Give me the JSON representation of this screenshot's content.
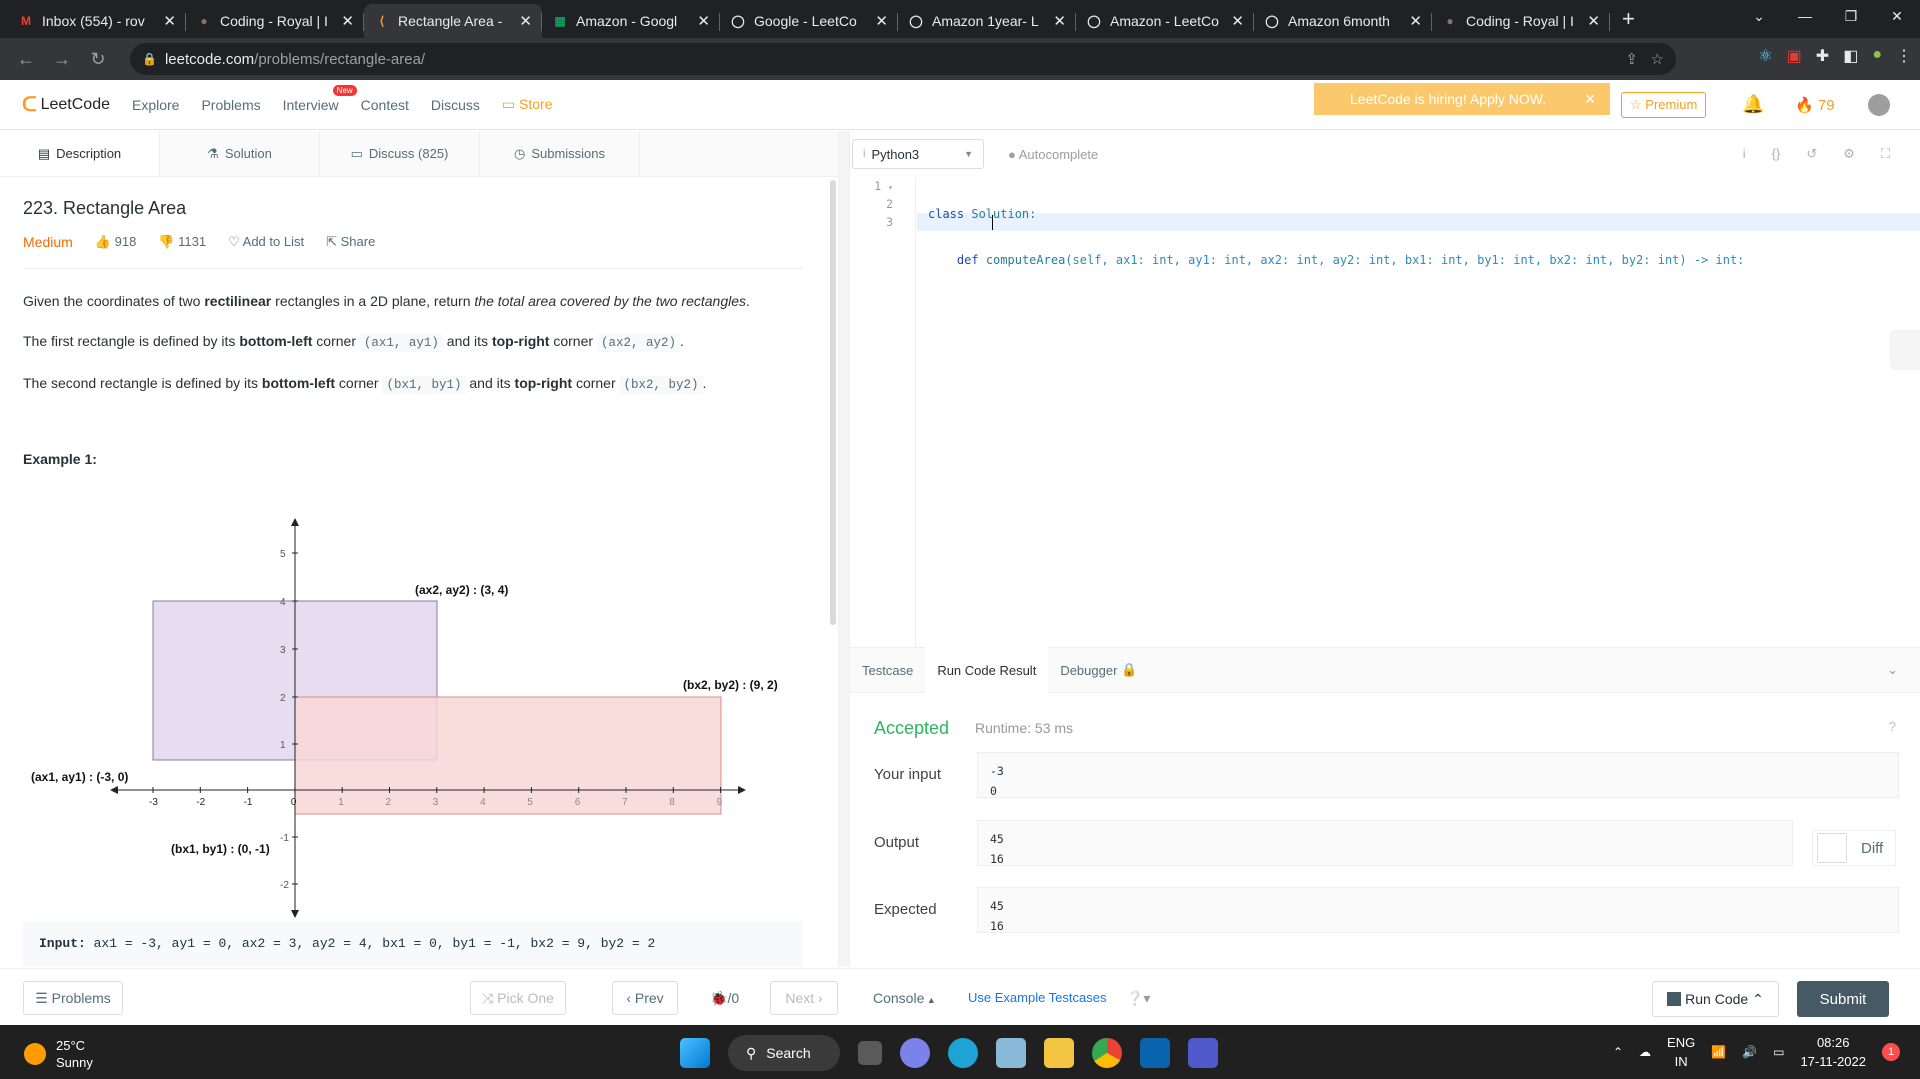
{
  "browser": {
    "tabs": [
      {
        "title": "Inbox (554) - rov",
        "icon": "gmail-icon",
        "color": "#ea4335",
        "glyph": "M"
      },
      {
        "title": "Coding - Royal | I",
        "icon": "avatar-icon",
        "color": "#8d6e63",
        "glyph": "●"
      },
      {
        "title": "Rectangle Area -",
        "icon": "leetcode-icon",
        "color": "#f89f1b",
        "glyph": "⟨"
      },
      {
        "title": "Amazon - Googl",
        "icon": "sheets-icon",
        "color": "#0f9d58",
        "glyph": "▦"
      },
      {
        "title": "Google - LeetCo",
        "icon": "leetcode-icon",
        "color": "#e8eaed",
        "glyph": "◯"
      },
      {
        "title": "Amazon 1year- L",
        "icon": "leetcode-icon",
        "color": "#e8eaed",
        "glyph": "◯"
      },
      {
        "title": "Amazon - LeetCo",
        "icon": "leetcode-icon",
        "color": "#e8eaed",
        "glyph": "◯"
      },
      {
        "title": "Amazon 6month",
        "icon": "leetcode-icon",
        "color": "#e8eaed",
        "glyph": "◯"
      },
      {
        "title": "Coding - Royal | I",
        "icon": "avatar-icon",
        "color": "#8d6e63",
        "glyph": "●"
      }
    ],
    "active_tab": 2,
    "url_host": "leetcode.com",
    "url_path": "/problems/rectangle-area/"
  },
  "nav": {
    "logo": "LeetCode",
    "links": [
      "Explore",
      "Problems",
      "Interview",
      "Contest",
      "Discuss"
    ],
    "new_badge": "New",
    "store": "Store",
    "hiring": "LeetCode is hiring! Apply NOW.",
    "premium": "Premium",
    "streak": "79"
  },
  "left_tabs": [
    "Description",
    "Solution",
    "Discuss (825)",
    "Submissions"
  ],
  "problem": {
    "title": "223. Rectangle Area",
    "difficulty": "Medium",
    "likes": "918",
    "dislikes": "1131",
    "add_to_list": "Add to List",
    "share": "Share",
    "p1_a": "Given the coordinates of two ",
    "p1_b": "rectilinear",
    "p1_c": " rectangles in a 2D plane, return ",
    "p1_d": "the total area covered by the two rectangles",
    "p1_e": ".",
    "p2_a": "The first rectangle is defined by its ",
    "p2_b": "bottom-left",
    "p2_c": " corner ",
    "p2_d": "(ax1, ay1)",
    "p2_e": " and its ",
    "p2_f": "top-right",
    "p2_g": " corner ",
    "p2_h": "(ax2, ay2)",
    "p2_i": ".",
    "p3_a": "The second rectangle is defined by its ",
    "p3_b": "bottom-left",
    "p3_c": " corner ",
    "p3_d": "(bx1, by1)",
    "p3_e": " and its ",
    "p3_f": "top-right",
    "p3_g": " corner ",
    "p3_h": "(bx2, by2)",
    "p3_i": ".",
    "example_label": "Example 1:",
    "input_label": "Input:",
    "input_text": "ax1 = -3, ay1 = 0, ax2 = 3, ay2 = 4, bx1 = 0, by1 = -1, bx2 = 9, by2 = 2",
    "graph": {
      "x_ticks": [
        "-3",
        "-2",
        "-1",
        "0",
        "1",
        "2",
        "3",
        "4",
        "5",
        "6",
        "7",
        "8",
        "9"
      ],
      "y_ticks": [
        "5",
        "4",
        "3",
        "2",
        "1",
        "-1",
        "-2"
      ],
      "label_a2": "(ax2, ay2) : (3, 4)",
      "label_b2": "(bx2, by2) : (9, 2)",
      "label_a1": "(ax1, ay1) : (-3, 0)",
      "label_b1": "(bx1, by1) : (0, -1)",
      "rect_a_color": "#e6def0",
      "rect_b_color": "#f8d7d7"
    }
  },
  "editor": {
    "language": "Python3",
    "autocomplete": "Autocomplete",
    "line_numbers": [
      "1",
      "2",
      "3"
    ],
    "code": {
      "l1_kw": "class",
      "l1_name": " Solution:",
      "l2_indent": "    ",
      "l2_kw": "def",
      "l2_fn": " computeArea",
      "l2_rest": "(self, ax1: int, ay1: int, ax2: int, ay2: int, bx1: int, by1: int, bx2: int, by2: int) -> int:"
    }
  },
  "result": {
    "tabs": [
      "Testcase",
      "Run Code Result",
      "Debugger"
    ],
    "status": "Accepted",
    "runtime": "Runtime: 53 ms",
    "your_input_label": "Your input",
    "your_input": [
      "-3",
      "0"
    ],
    "output_label": "Output",
    "output": [
      "45",
      "16"
    ],
    "expected_label": "Expected",
    "expected": [
      "45",
      "16"
    ],
    "diff": "Diff"
  },
  "footer": {
    "problems": "Problems",
    "pick_one": "Pick One",
    "prev": "Prev",
    "counter": "/0",
    "next": "Next",
    "console": "Console",
    "use_example": "Use Example Testcases",
    "run_code": "Run Code",
    "submit": "Submit"
  },
  "taskbar": {
    "temp": "25°C",
    "weather": "Sunny",
    "search": "Search",
    "lang1": "ENG",
    "lang2": "IN",
    "time": "08:26",
    "date": "17-11-2022",
    "notifications": "1"
  }
}
